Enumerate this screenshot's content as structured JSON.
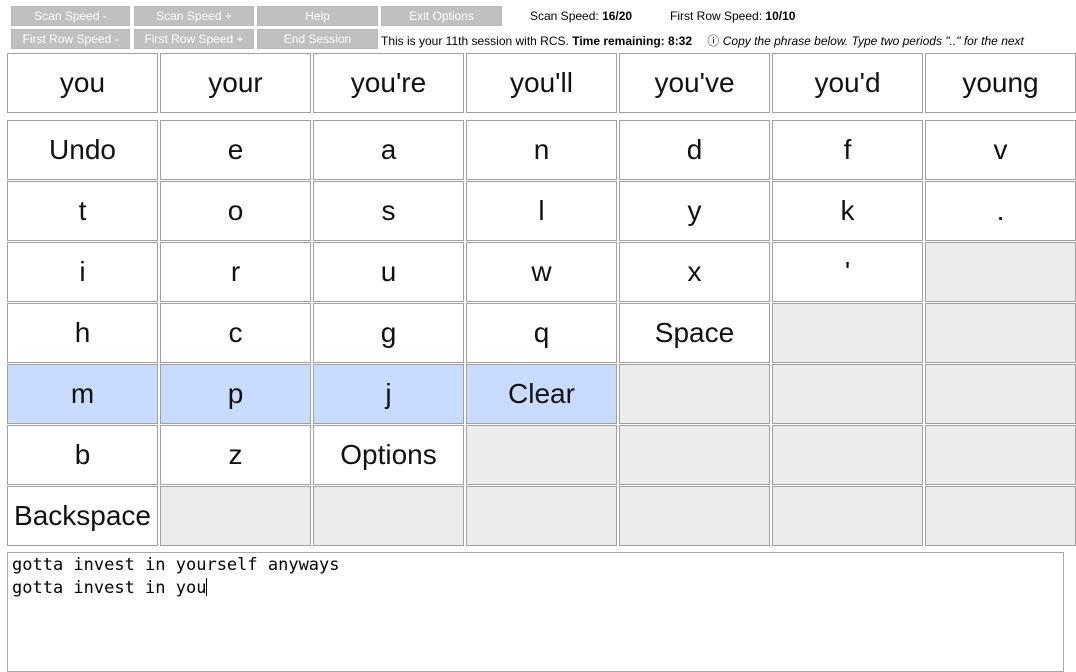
{
  "toolbar": {
    "scan_speed_minus": "Scan Speed -",
    "scan_speed_plus": "Scan Speed +",
    "help": "Help",
    "exit_options": "Exit Options",
    "first_row_speed_minus": "First Row Speed -",
    "first_row_speed_plus": "First Row Speed +",
    "end_session": "End Session"
  },
  "status": {
    "scan_speed_label": "Scan Speed:",
    "scan_speed_value": "16/20",
    "first_row_speed_label": "First Row Speed:",
    "first_row_speed_value": "10/10",
    "session_text": "This is your 11th session with RCS.",
    "time_label": "Time remaining:",
    "time_value": "8:32",
    "info_icon": "ⓘ",
    "instruction": "Copy the phrase below. Type two periods \"..\" for the next"
  },
  "words": [
    "you",
    "your",
    "you're",
    "you'll",
    "you've",
    "you'd",
    "young"
  ],
  "rows": [
    [
      "Undo",
      "e",
      "a",
      "n",
      "d",
      "f",
      "v"
    ],
    [
      "t",
      "o",
      "s",
      "l",
      "y",
      "k",
      "."
    ],
    [
      "i",
      "r",
      "u",
      "w",
      "x",
      "'",
      ""
    ],
    [
      "h",
      "c",
      "g",
      "q",
      "Space",
      "",
      ""
    ],
    [
      "m",
      "p",
      "j",
      "Clear",
      "",
      "",
      ""
    ],
    [
      "b",
      "z",
      "Options",
      "",
      "",
      "",
      ""
    ],
    [
      "Backspace",
      "",
      "",
      "",
      "",
      "",
      ""
    ]
  ],
  "highlighted_row": 4,
  "colors": {
    "highlight": "#c8dcff",
    "empty": "#ececec",
    "button": "#c0c0c0"
  },
  "editor": {
    "target_phrase": "gotta invest in yourself anyways",
    "typed_text": "gotta invest in you"
  }
}
